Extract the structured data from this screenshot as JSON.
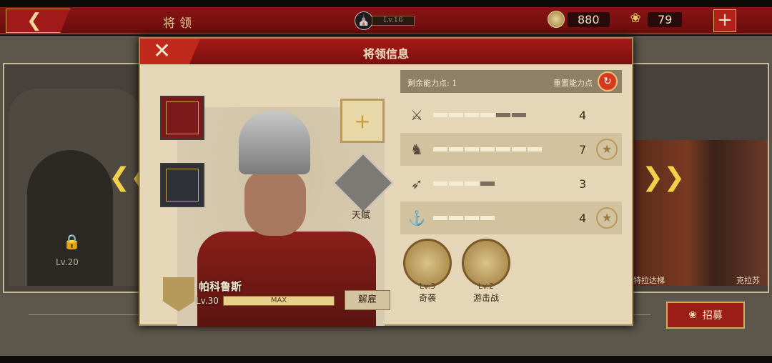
{
  "topbar": {
    "title": "将领",
    "level": "Lv.16",
    "coins": "880",
    "laurels": "79",
    "back_icon": "back-arrow-icon",
    "plus_label": "+"
  },
  "background": {
    "locked_level": "Lv.20",
    "recruit_label": "招募",
    "right_name_1": "特拉达梯",
    "right_name_2": "克拉苏"
  },
  "dialog": {
    "title": "将领信息",
    "close_label": "✕",
    "talent_label": "天赋",
    "hero": {
      "name": "帕科鲁斯",
      "level": "Lv.30",
      "xp_label": "MAX",
      "xp_fraction": 1.0
    },
    "dismiss_label": "解雇",
    "stats_header": {
      "points_label": "剩余能力点: 1",
      "reset_label": "重置能力点"
    },
    "stats": [
      {
        "icon": "sword-icon",
        "value": "4",
        "max": 6,
        "badge": false
      },
      {
        "icon": "horse-icon",
        "value": "7",
        "max": 7,
        "badge": true
      },
      {
        "icon": "bow-icon",
        "value": "3",
        "max": 4,
        "badge": false
      },
      {
        "icon": "anchor-icon",
        "value": "4",
        "max": 4,
        "badge": true
      }
    ],
    "tactics": [
      {
        "level": "Lv.3",
        "name": "奇袭"
      },
      {
        "level": "Lv.2",
        "name": "游击战"
      }
    ]
  }
}
